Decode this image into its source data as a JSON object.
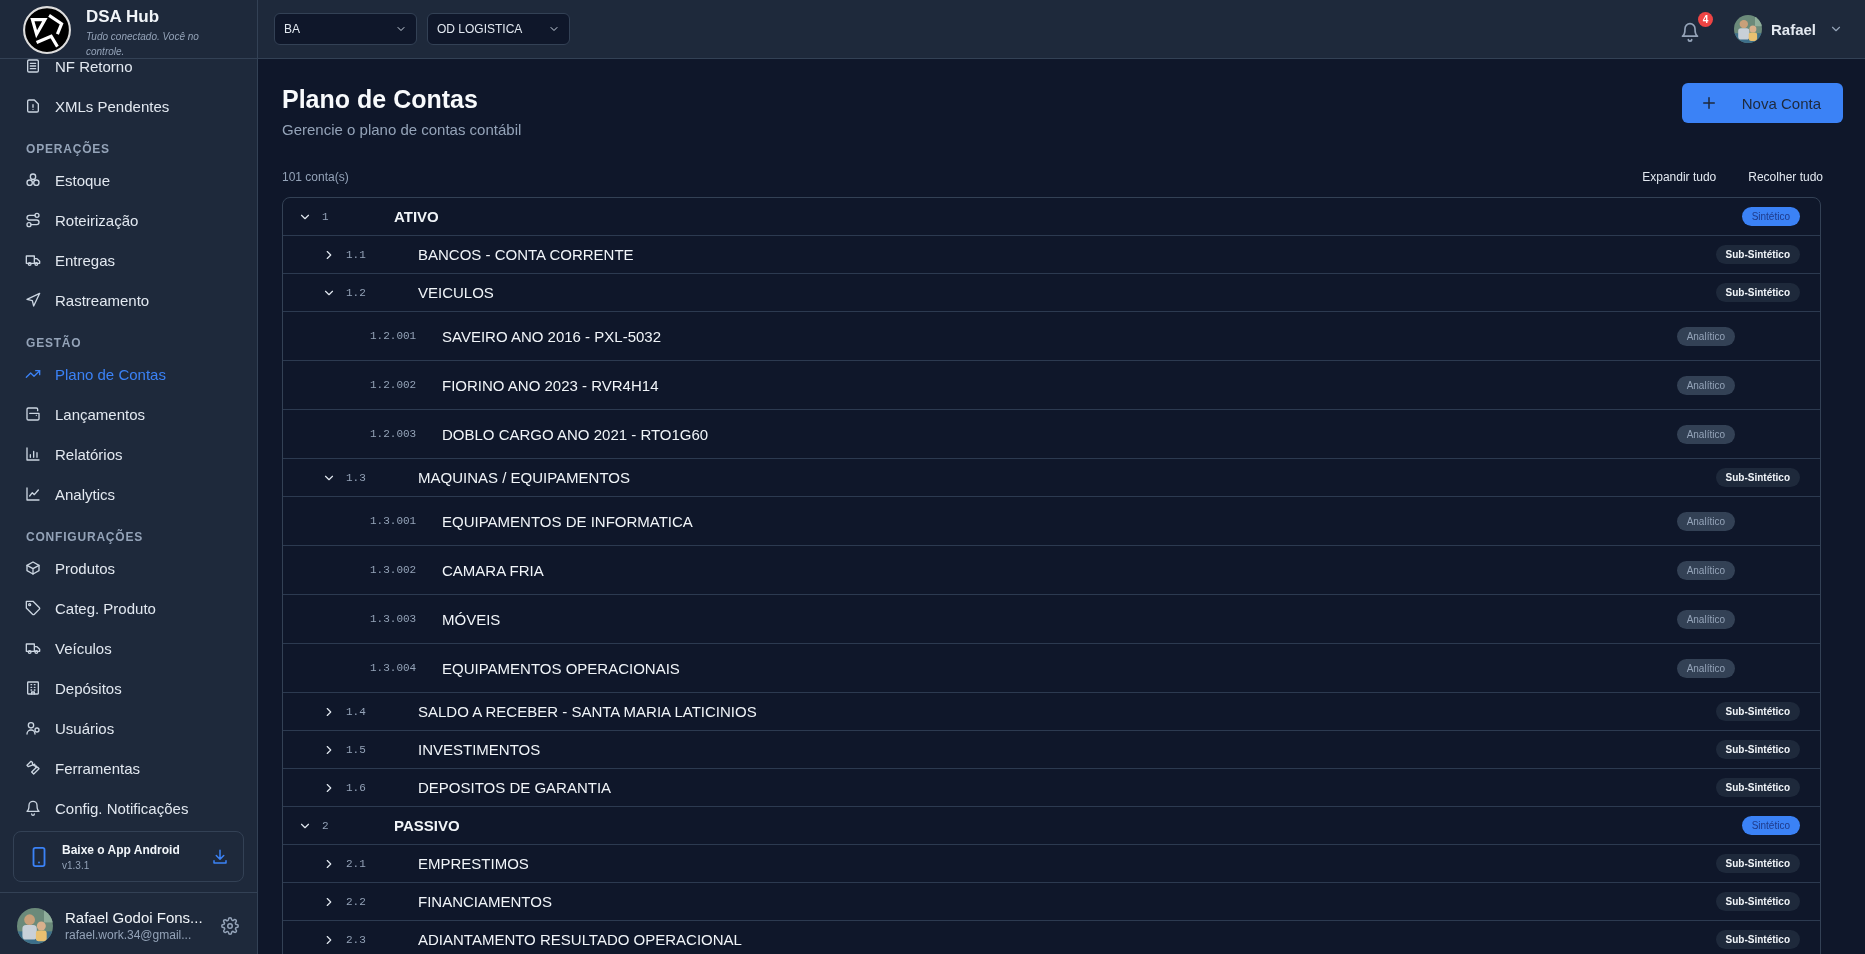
{
  "sidebar": {
    "brand": {
      "title": "DSA Hub",
      "tagline": "Tudo conectado. Você no controle."
    },
    "sections": [
      {
        "items": [
          {
            "label": "NF Retorno",
            "selected": false
          },
          {
            "label": "XMLs Pendentes",
            "selected": false
          }
        ]
      },
      {
        "label": "OPERAÇÕES",
        "items": [
          {
            "label": "Estoque",
            "selected": false
          },
          {
            "label": "Roteirização",
            "selected": false
          },
          {
            "label": "Entregas",
            "selected": false
          },
          {
            "label": "Rastreamento",
            "selected": false
          }
        ]
      },
      {
        "label": "GESTÃO",
        "items": [
          {
            "label": "Plano de Contas",
            "selected": true
          },
          {
            "label": "Lançamentos",
            "selected": false
          },
          {
            "label": "Relatórios",
            "selected": false
          },
          {
            "label": "Analytics",
            "selected": false
          }
        ]
      },
      {
        "label": "CONFIGURAÇÕES",
        "items": [
          {
            "label": "Produtos",
            "selected": false
          },
          {
            "label": "Categ. Produto",
            "selected": false
          },
          {
            "label": "Veículos",
            "selected": false
          },
          {
            "label": "Depósitos",
            "selected": false
          },
          {
            "label": "Usuários",
            "selected": false
          },
          {
            "label": "Ferramentas",
            "selected": false
          },
          {
            "label": "Config. Notificações",
            "selected": false
          }
        ]
      }
    ],
    "app_card": {
      "title": "Baixe o App Android",
      "version": "v1.3.1"
    },
    "user": {
      "name": "Rafael Godoi Fons...",
      "email": "rafael.work.34@gmail..."
    }
  },
  "topbar": {
    "selects": [
      {
        "value": "BA"
      },
      {
        "value": "OD LOGISTICA"
      }
    ],
    "notifications": "4",
    "user_name": "Rafael"
  },
  "page": {
    "title": "Plano de Contas",
    "subtitle": "Gerencie o plano de contas contábil",
    "primary_button": "Nova Conta",
    "count": "101 conta(s)",
    "actions": [
      "Expandir tudo",
      "Recolher tudo"
    ]
  },
  "tree": [
    {
      "code": "1",
      "name": "ATIVO",
      "type": "Sintético",
      "kind": "sintetico",
      "expanded": true,
      "children": [
        {
          "code": "1.1",
          "name": "BANCOS - CONTA CORRENTE",
          "type": "Sub-Sintético",
          "kind": "subsintetico",
          "expanded": false
        },
        {
          "code": "1.2",
          "name": "VEICULOS",
          "type": "Sub-Sintético",
          "kind": "subsintetico",
          "expanded": true,
          "children": [
            {
              "code": "1.2.001",
              "name": "SAVEIRO ANO 2016 - PXL-5032",
              "type": "Analítico",
              "kind": "analitico"
            },
            {
              "code": "1.2.002",
              "name": "FIORINO ANO 2023 - RVR4H14",
              "type": "Analítico",
              "kind": "analitico"
            },
            {
              "code": "1.2.003",
              "name": "DOBLO CARGO ANO 2021 - RTO1G60",
              "type": "Analítico",
              "kind": "analitico"
            }
          ]
        },
        {
          "code": "1.3",
          "name": "MAQUINAS / EQUIPAMENTOS",
          "type": "Sub-Sintético",
          "kind": "subsintetico",
          "expanded": true,
          "children": [
            {
              "code": "1.3.001",
              "name": "EQUIPAMENTOS DE INFORMATICA",
              "type": "Analítico",
              "kind": "analitico"
            },
            {
              "code": "1.3.002",
              "name": "CAMARA FRIA",
              "type": "Analítico",
              "kind": "analitico"
            },
            {
              "code": "1.3.003",
              "name": "MÓVEIS",
              "type": "Analítico",
              "kind": "analitico"
            },
            {
              "code": "1.3.004",
              "name": "EQUIPAMENTOS OPERACIONAIS",
              "type": "Analítico",
              "kind": "analitico"
            }
          ]
        },
        {
          "code": "1.4",
          "name": "SALDO A RECEBER - SANTA MARIA LATICINIOS",
          "type": "Sub-Sintético",
          "kind": "subsintetico",
          "expanded": false
        },
        {
          "code": "1.5",
          "name": "INVESTIMENTOS",
          "type": "Sub-Sintético",
          "kind": "subsintetico",
          "expanded": false
        },
        {
          "code": "1.6",
          "name": "DEPOSITOS DE GARANTIA",
          "type": "Sub-Sintético",
          "kind": "subsintetico",
          "expanded": false
        }
      ]
    },
    {
      "code": "2",
      "name": "PASSIVO",
      "type": "Sintético",
      "kind": "sintetico",
      "expanded": true,
      "children": [
        {
          "code": "2.1",
          "name": "EMPRESTIMOS",
          "type": "Sub-Sintético",
          "kind": "subsintetico",
          "expanded": false
        },
        {
          "code": "2.2",
          "name": "FINANCIAMENTOS",
          "type": "Sub-Sintético",
          "kind": "subsintetico",
          "expanded": false
        },
        {
          "code": "2.3",
          "name": "ADIANTAMENTO RESULTADO OPERACIONAL",
          "type": "Sub-Sintético",
          "kind": "subsintetico",
          "expanded": false
        }
      ]
    }
  ]
}
